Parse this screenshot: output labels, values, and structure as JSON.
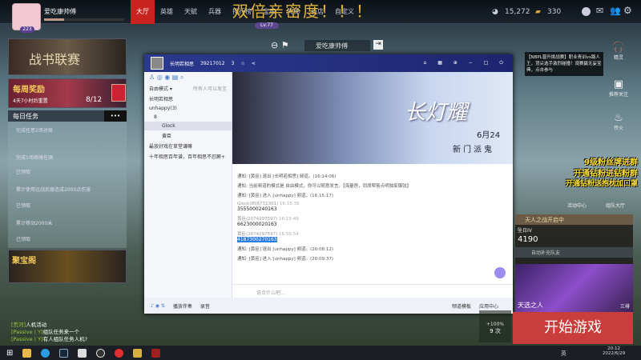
{
  "profile": {
    "name": "爱吃康帅傅",
    "level": "223",
    "rank_badge": "Lv.77"
  },
  "tabs": [
    "大厅",
    "英雄",
    "天赋",
    "兵器",
    "排行榜",
    "宝库",
    "天梯",
    "商店",
    "自定义"
  ],
  "promo_overlay": "双倍亲密度！！！",
  "currency": {
    "coins": "15,272",
    "gold": "330"
  },
  "lobby": {
    "player_name": "爱吃康帅傅"
  },
  "left": {
    "league_banner": "战书联赛",
    "weekly": {
      "title": "每周奖励",
      "reset": "4天7小时后重置",
      "progress": "8/12"
    },
    "daily": {
      "title": "每日任务",
      "more": "•••",
      "tasks": [
        {
          "name": "完成任意2场对局",
          "status": ""
        },
        {
          "name": "完成1场顺境任酒",
          "status": "已领取"
        },
        {
          "name": "累计使用远战武器造成2000点伤害",
          "status": "已领取"
        },
        {
          "name": "累计移动2000米",
          "status": "已领取"
        }
      ]
    },
    "treasure": "聚宝阁"
  },
  "chat_window": {
    "channel": "长明若相思",
    "id": "39217012",
    "members": "3",
    "mode": "自由模式 ▾",
    "mode_hint": "所有人可以发言",
    "tree": [
      "长明若相思",
      "unhappy(3)",
      "8",
      "Glock",
      "黄臣",
      "最放好戏在草堂谦嘛",
      "十年相思百年谱，百年相思不忍厮+"
    ],
    "banner_title": "长灯耀",
    "banner_date": "6月24",
    "banner_sub": "新门派鬼",
    "messages": [
      {
        "type": "notice",
        "text": "通知: [黄臣] 退出 [长明若相思] 频道。(16:14:06)"
      },
      {
        "type": "notice",
        "text": "通知: 当前频道的模式是 自由模式，你可以随意发言。【海量房，同席帮售点明独家爆弦】"
      },
      {
        "type": "notice",
        "text": "通知: [黄臣] 进入 [unhappy] 频道。(16:15:17)"
      },
      {
        "type": "user",
        "author": "Glock(856731301)",
        "time": "16:15:35",
        "text": "3555000240163"
      },
      {
        "type": "user",
        "author": "黄臣(2074297597)",
        "time": "16:15:49",
        "text": "6623000020163"
      },
      {
        "type": "user",
        "author": "黄臣(2074297597)",
        "time": "16:56:54",
        "text": "4187300270163",
        "selected": true
      },
      {
        "type": "notice",
        "text": "通知: [黄臣] 退出 [unhappy] 频道。(20:08:12)"
      },
      {
        "type": "notice",
        "text": "通知: [黄臣] 进入 [unhappy] 频道。(20:09:37)"
      }
    ],
    "input_placeholder": "说点什么吧...",
    "toolbar": [
      "播放伴奏",
      "录音",
      "频道模板",
      "应用中心"
    ]
  },
  "right": {
    "notice": "【NBPL晋升挑战赛】职业青训vs路人王，顶尖选手激烈碰撞！观赛赢无妄宝典，点击参与",
    "icons": [
      "精灵",
      "推荐关注",
      "传火"
    ],
    "fan_text": [
      "9级粉丝牌进群",
      "开通钻粉进钻粉群",
      "开通钻粉送抱枕加口罩"
    ],
    "activity": "活动中心",
    "team_hall": "组队大厅",
    "event": {
      "title": "天人之战开启中",
      "rank": "坠日IV",
      "score": "4190",
      "auto_fill": "自动补充队友"
    },
    "hero_mode": "天选之人",
    "hero_mode_tag": "三排",
    "start": "开始游戏",
    "boost": {
      "pct": "+100%",
      "count": "9 次"
    }
  },
  "game_chat": [
    {
      "ch": "[荒河]",
      "text": "人机活动"
    },
    {
      "ch": "[Passive丨Y]",
      "text": "组队任务来一个"
    },
    {
      "ch": "[Passive丨Y]",
      "text": "有人组队任务人机?"
    }
  ],
  "taskbar": {
    "time": "20:12",
    "date": "2022/6/29",
    "lang": "英"
  },
  "colors": {
    "accent": "#c8231f",
    "gold": "#e0b43c",
    "chat_header": "#2b3a8f"
  }
}
